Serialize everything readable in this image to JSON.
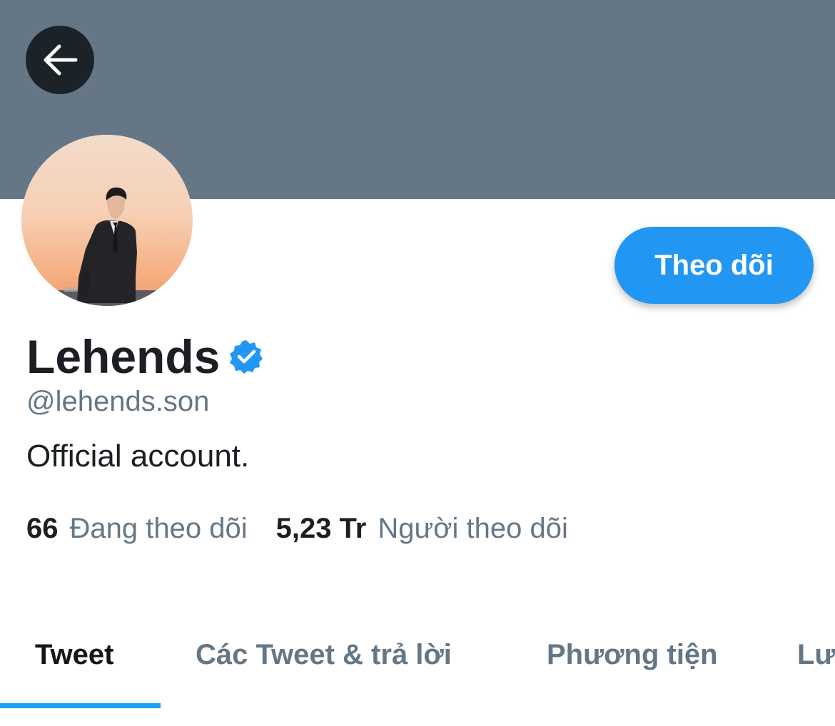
{
  "header": {
    "back_icon": "arrow-left-icon",
    "banner_color": "#657786"
  },
  "profile": {
    "display_name": "Lehends",
    "verified_icon": "verified-badge-icon",
    "handle": "@lehends.son",
    "bio": "Official account.",
    "follow_button_label": "Theo dõi",
    "accent_color": "#1da1f2"
  },
  "stats": {
    "following_count": "66",
    "following_label": "Đang theo dõi",
    "followers_count": "5,23 Tr",
    "followers_label": "Người theo dõi"
  },
  "tabs": [
    {
      "label": "Tweet",
      "active": true
    },
    {
      "label": "Các Tweet & trả lời",
      "active": false
    },
    {
      "label": "Phương tiện",
      "active": false
    },
    {
      "label": "Lượt thích",
      "active": false
    }
  ]
}
